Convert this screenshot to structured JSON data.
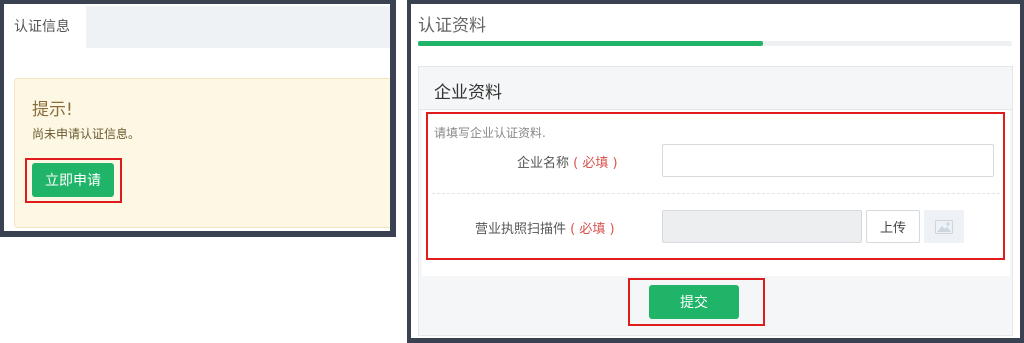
{
  "left": {
    "tab_label": "认证信息",
    "alert": {
      "title": "提示!",
      "message": "尚未申请认证信息。",
      "apply_button": "立即申请"
    }
  },
  "right": {
    "page_title": "认证资料",
    "progress_percent": 58,
    "section_title": "企业资料",
    "hint": "请填写企业认证资料.",
    "fields": [
      {
        "label": "企业名称",
        "required_mark": "( 必填 )",
        "value": ""
      },
      {
        "label": "营业执照扫描件",
        "required_mark": "( 必填 )",
        "value": ""
      }
    ],
    "upload_button": "上传",
    "submit_button": "提交"
  },
  "colors": {
    "accent_green": "#1fb467",
    "highlight_red": "#e01b1b",
    "frame_dark": "#3a4150",
    "alert_bg": "#fdf8e4"
  },
  "icons": {
    "thumbnail": "image-placeholder-icon"
  }
}
